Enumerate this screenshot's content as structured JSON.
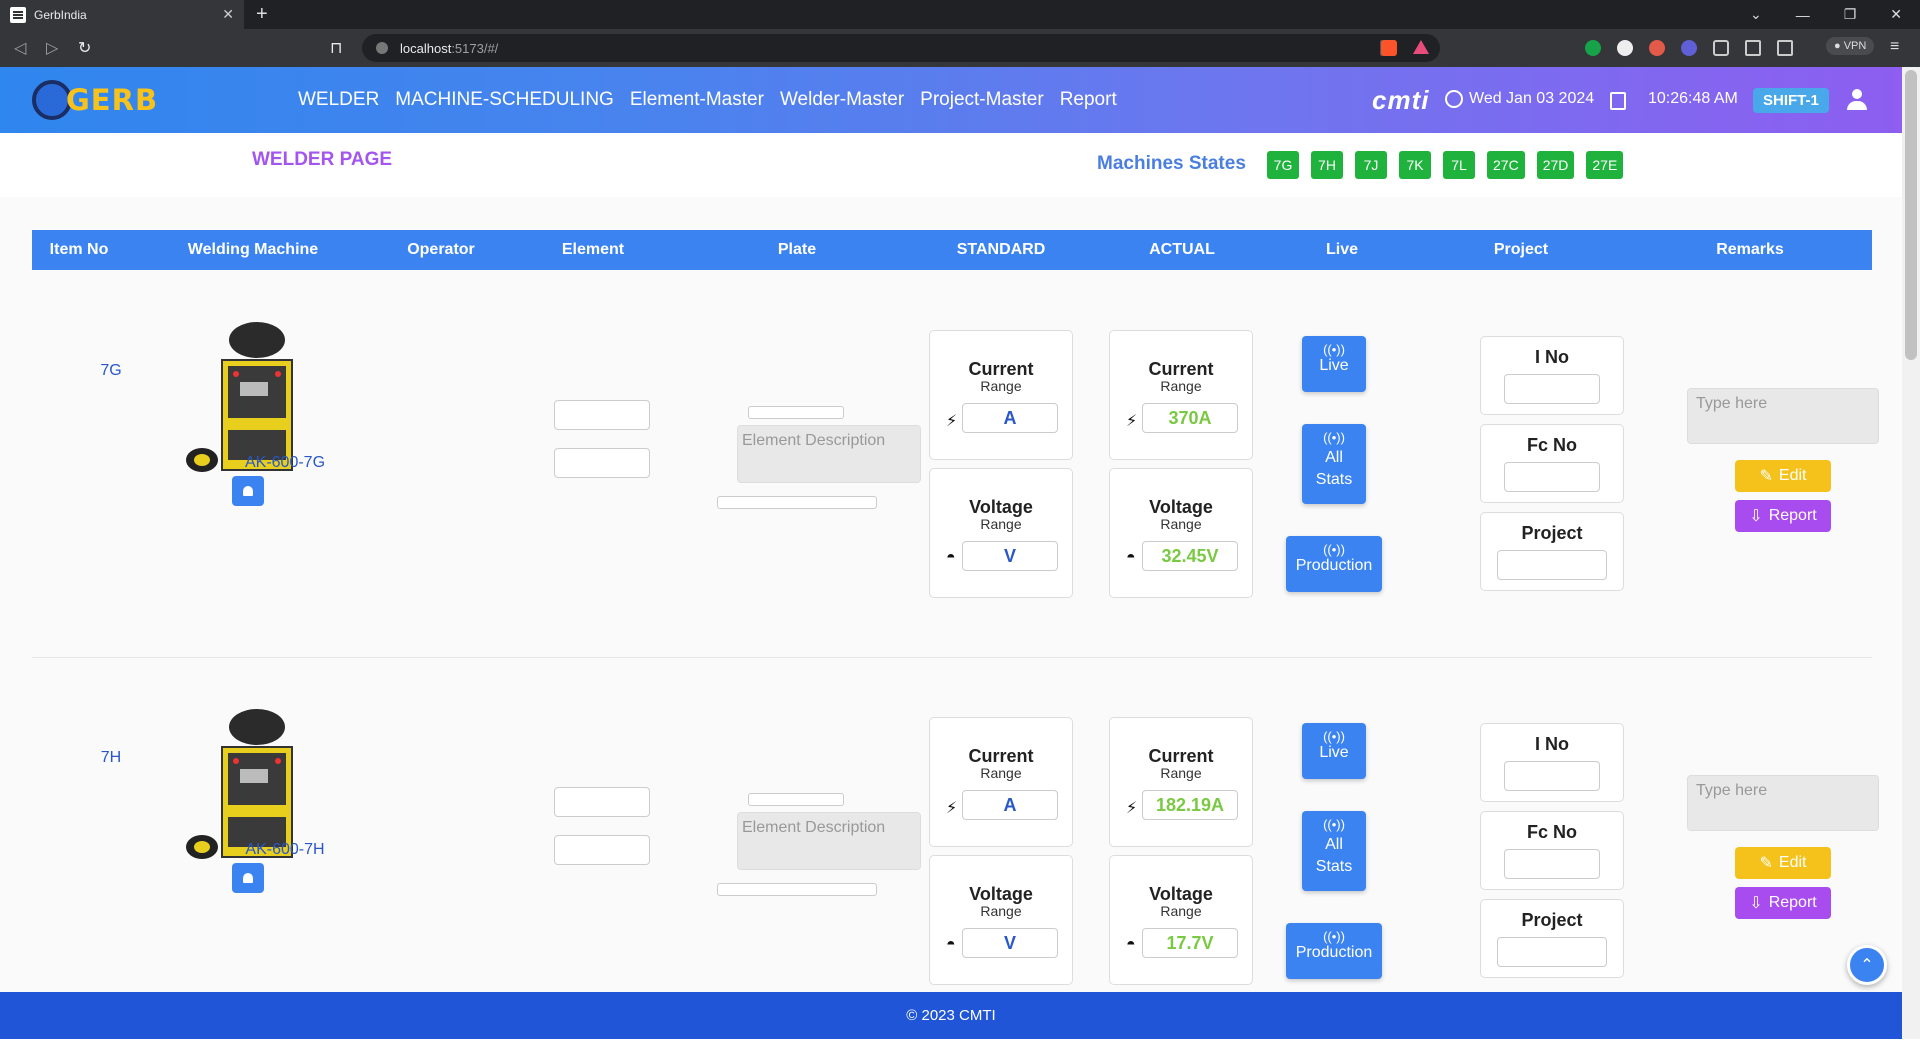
{
  "browser": {
    "tab_title": "GerbIndia",
    "url_host": "localhost",
    "url_path": ":5173/#/",
    "vpn_label": "VPN"
  },
  "app": {
    "logo_text": "GERB",
    "nav": [
      "WELDER",
      "MACHINE-SCHEDULING",
      "Element-Master",
      "Welder-Master",
      "Project-Master",
      "Report"
    ],
    "brand": "cmti",
    "date": "Wed Jan 03 2024",
    "time": "10:26:48 AM",
    "shift": "SHIFT-1"
  },
  "subheader": {
    "page_title": "WELDER PAGE",
    "states_label": "Machines States",
    "states": [
      "7G",
      "7H",
      "7J",
      "7K",
      "7L",
      "27C",
      "27D",
      "27E"
    ]
  },
  "table": {
    "headers": [
      "Item No",
      "Welding Machine",
      "Operator",
      "Element",
      "Plate",
      "STANDARD",
      "ACTUAL",
      "Live",
      "Project",
      "Remarks"
    ],
    "desc_placeholder": "Element Description",
    "remarks_placeholder": "Type here",
    "current_title": "Current",
    "voltage_title": "Voltage",
    "range_sub": "Range",
    "live_btn": "Live",
    "stats_btn_line1": "All",
    "stats_btn_line2": "Stats",
    "production_btn": "Production",
    "ino_label": "I No",
    "fcno_label": "Fc No",
    "project_label": "Project",
    "edit_btn": "Edit",
    "report_btn": "Report",
    "rows": [
      {
        "item_no": "7G",
        "machine": "AK-600-7G",
        "std_current": "A",
        "std_voltage": "V",
        "act_current": "370A",
        "act_voltage": "32.45V"
      },
      {
        "item_no": "7H",
        "machine": "AK-600-7H",
        "std_current": "A",
        "std_voltage": "V",
        "act_current": "182.19A",
        "act_voltage": "17.7V"
      }
    ]
  },
  "footer": {
    "text": "© 2023 CMTI"
  },
  "colors": {
    "accent": "#3b83f0",
    "state_green": "#1fb33d",
    "title_purple": "#a355f0",
    "actual_green": "#7ac943"
  }
}
